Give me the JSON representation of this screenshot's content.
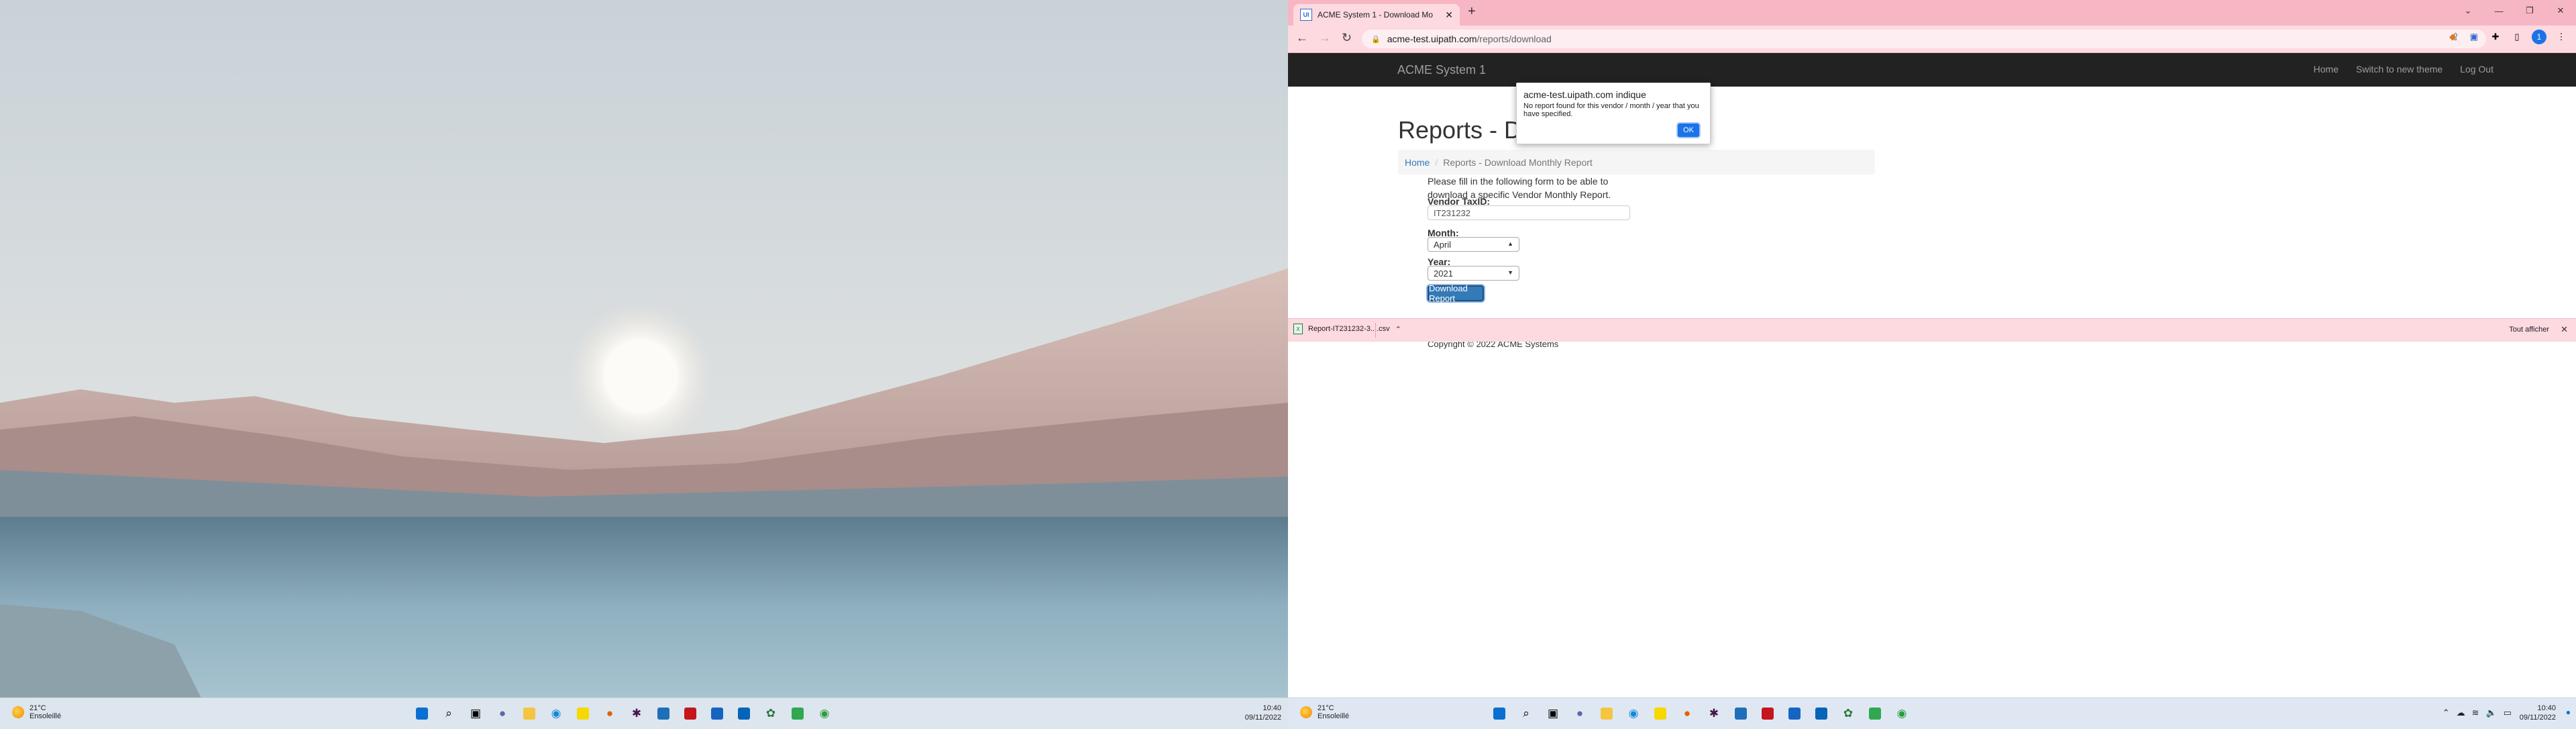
{
  "left_taskbar": {
    "weather_temp": "21°C",
    "weather_desc": "Ensoleillé",
    "time": "10:40",
    "date": "09/11/2022"
  },
  "browser": {
    "tab_title": "ACME System 1 - Download Mo",
    "tab_favicon": "UI",
    "url_host": "acme-test.uipath.com",
    "url_path": "/reports/download",
    "profile_initial": "1"
  },
  "site": {
    "brand": "ACME System 1",
    "nav": {
      "home": "Home",
      "switch_theme": "Switch to new theme",
      "logout": "Log Out"
    },
    "heading": "Reports - Download M",
    "breadcrumb": {
      "home": "Home",
      "current": "Reports - Download Monthly Report"
    },
    "intro": "Please fill in the following form to be able to download a specific Vendor Monthly Report.",
    "vendor_label": "Vendor TaxID:",
    "vendor_value": "IT231232",
    "month_label": "Month:",
    "month_value": "April",
    "year_label": "Year:",
    "year_value": "2021",
    "download_button": "Download Report",
    "footer": "Copyright © 2022 ACME Systems"
  },
  "dialog": {
    "title": "acme-test.uipath.com indique",
    "message": "No report found for this vendor / month / year that you have specified.",
    "ok": "OK"
  },
  "download_bar": {
    "file_name": "Report-IT231232-3....csv",
    "show_all": "Tout afficher"
  },
  "right_taskbar": {
    "weather_temp": "21°C",
    "weather_desc": "Ensoleillé",
    "time": "10:40",
    "date": "09/11/2022"
  }
}
